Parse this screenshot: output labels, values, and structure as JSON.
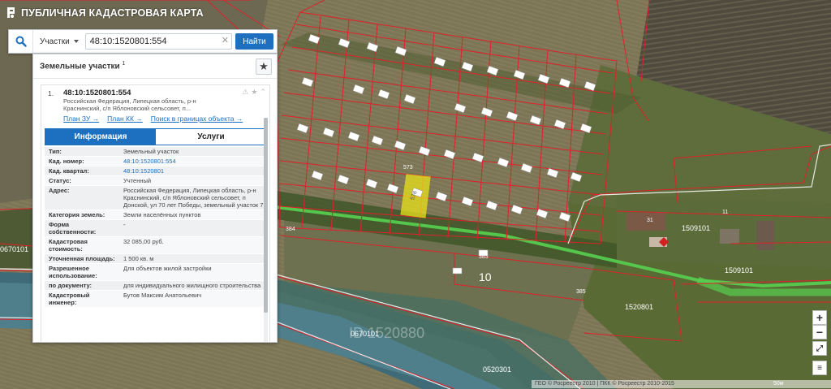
{
  "app": {
    "title": "ПУБЛИЧНАЯ КАДАСТРОВАЯ КАРТА"
  },
  "search": {
    "type": "Участки",
    "value": "48:10:1520801:554",
    "button": "Найти"
  },
  "panel": {
    "title": "Земельные участки",
    "count": "1",
    "item": {
      "num": "1.",
      "cadnum": "48:10:1520801:554",
      "address": "Российская Федерация, Липецкая область, р-н Краснинский, с/п Яблоновский сельсовет, п...",
      "links": [
        "План ЗУ →",
        "План КК →",
        "Поиск в границах объекта →"
      ]
    },
    "tabs": [
      "Информация",
      "Услуги"
    ],
    "rows": [
      {
        "k": "Тип:",
        "v": "Земельный участок"
      },
      {
        "k": "Кад. номер:",
        "v": "48:10:1520801:554"
      },
      {
        "k": "Кад. квартал:",
        "v": "48:10:1520801"
      },
      {
        "k": "Статус:",
        "v": "Учтенный"
      },
      {
        "k": "Адрес:",
        "v": "Российская Федерация, Липецкая область, р-н Краснинский, с/п Яблоновский сельсовет, п Донской, ул 70 лет Победы, земельный участок 7"
      },
      {
        "k": "Категория земель:",
        "v": "Земли населённых пунктов"
      },
      {
        "k": "Форма собственности:",
        "v": "-"
      },
      {
        "k": "Кадастровая стоимость:",
        "v": "32 085,00 руб."
      },
      {
        "k": "Уточненная площадь:",
        "v": "1 500 кв. м"
      },
      {
        "k": "Разрешенное использование:",
        "v": "Для объектов жилой застройки"
      },
      {
        "k": "по документу:",
        "v": "для индивидуального жилищного строительства"
      },
      {
        "k": "Кадастровый инженер:",
        "v": "Бутов Максим Анатольевич"
      }
    ]
  },
  "map": {
    "labels": [
      "573",
      "576",
      "10",
      "384",
      "383",
      "385",
      "11",
      "31",
      "0670101",
      "1520801",
      "1509101",
      "1509101",
      "0670101",
      "0520301",
      "ID 1520880"
    ],
    "attribution": "ГЕО © Росреестр 2010 | ПКК © Росреестр 2010-2015",
    "scale": "50м",
    "highlight_color": "#e8e21a",
    "boundary_color": "#e0202a"
  },
  "zoom": {
    "in": "+",
    "out": "−"
  }
}
